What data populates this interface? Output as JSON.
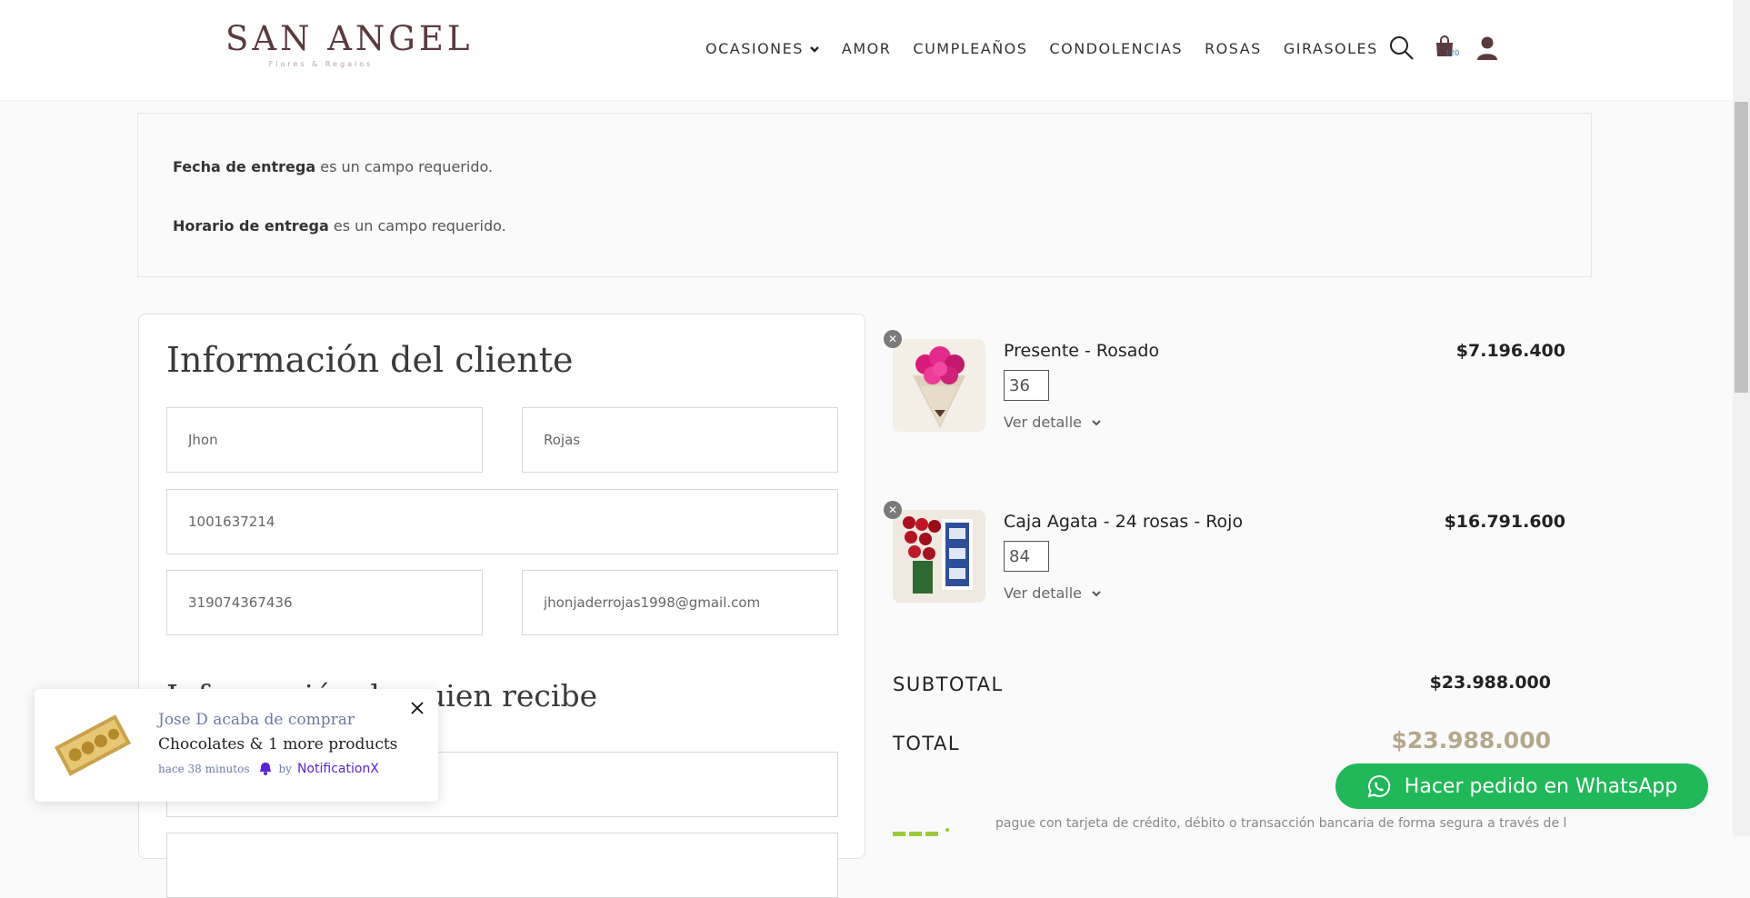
{
  "header": {
    "logo_text": "SAN ANGEL",
    "logo_sub": "Flores & Regalos",
    "nav": [
      "OCASIONES",
      "AMOR",
      "CUMPLEAÑOS",
      "CONDOLENCIAS",
      "ROSAS",
      "GIRASOLES"
    ],
    "cart_count": "120"
  },
  "notice": {
    "line1_bold": "Fecha de entrega",
    "line1_rest": " es un campo requerido.",
    "line2_bold": "Horario de entrega",
    "line2_rest": " es un campo requerido."
  },
  "form": {
    "title": "Información del cliente",
    "first_name": "Jhon",
    "last_name": "Rojas",
    "document": "1001637214",
    "phone": "319074367436",
    "email": "jhonjaderrojas1998@gmail.com",
    "section2_title": "Información de quien recibe"
  },
  "cart": {
    "items": [
      {
        "name": "Presente - Rosado",
        "price": "$7.196.400",
        "qty": "36",
        "detail_label": "Ver detalle"
      },
      {
        "name": "Caja Agata - 24 rosas - Rojo",
        "price": "$16.791.600",
        "qty": "84",
        "detail_label": "Ver detalle"
      }
    ],
    "subtotal_label": "SUBTOTAL",
    "subtotal_value": "$23.988.000",
    "total_label": "TOTAL",
    "total_value": "$23.988.000",
    "payment_note": "pague con tarjeta de crédito, débito o transacción bancaria de forma segura a través de los"
  },
  "notification": {
    "title": "Jose D acaba de comprar",
    "desc": "Chocolates & 1 more products",
    "time": "hace 38 minutos",
    "by": "by",
    "brand": "NotificationX"
  },
  "whatsapp": {
    "label": "Hacer pedido en WhatsApp"
  },
  "colors": {
    "brand": "#5a3a3d",
    "whatsapp": "#20b858",
    "total": "#b4a88a"
  }
}
